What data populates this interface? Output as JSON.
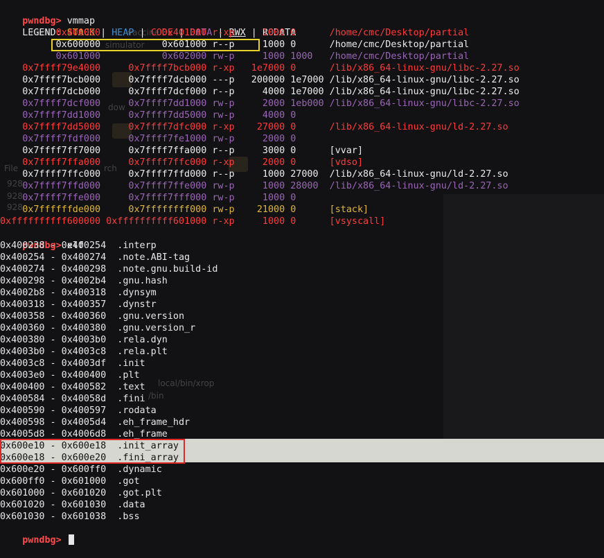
{
  "prompt": "pwndbg>",
  "colors": {
    "background": "#121214",
    "prompt": "#ff4b4b",
    "stack": "#e0b63a",
    "heap": "#3f8ed6",
    "code": "#ff3b3b",
    "data": "#9b65b8",
    "rodata": "#ececec",
    "highlight_band": "#d6d7d1",
    "yellow_box": "#e8d22a",
    "red_box": "#e02828"
  },
  "commands": {
    "vmmap": "vmmap",
    "elf": "elf"
  },
  "legend": {
    "prefix": "LEGEND: ",
    "stack": "STACK",
    "heap": "HEAP",
    "code": "CODE",
    "data": "DATA",
    "rwx": "RWX",
    "rodata": "RODATA",
    "sep": " | "
  },
  "vmmap_rows": [
    {
      "text": "          0x400000           0x401000 r-xp     1000 0      /home/cmc/Desktop/partial",
      "kind": "code"
    },
    {
      "text": "          0x600000           0x601000 r--p     1000 0      /home/cmc/Desktop/partial",
      "kind": "rodata"
    },
    {
      "text": "          0x601000           0x602000 rw-p     1000 1000   /home/cmc/Desktop/partial",
      "kind": "data"
    },
    {
      "text": "    0x7ffff79e4000     0x7ffff7bcb000 r-xp   1e7000 0      /lib/x86_64-linux-gnu/libc-2.27.so",
      "kind": "code"
    },
    {
      "text": "    0x7ffff7bcb000     0x7ffff7dcb000 ---p   200000 1e7000 /lib/x86_64-linux-gnu/libc-2.27.so",
      "kind": "rodata"
    },
    {
      "text": "    0x7ffff7dcb000     0x7ffff7dcf000 r--p     4000 1e7000 /lib/x86_64-linux-gnu/libc-2.27.so",
      "kind": "rodata"
    },
    {
      "text": "    0x7ffff7dcf000     0x7ffff7dd1000 rw-p     2000 1eb000 /lib/x86_64-linux-gnu/libc-2.27.so",
      "kind": "data"
    },
    {
      "text": "    0x7ffff7dd1000     0x7ffff7dd5000 rw-p     4000 0",
      "kind": "data"
    },
    {
      "text": "    0x7ffff7dd5000     0x7ffff7dfc000 r-xp    27000 0      /lib/x86_64-linux-gnu/ld-2.27.so",
      "kind": "code"
    },
    {
      "text": "    0x7ffff7fdf000     0x7ffff7fe1000 rw-p     2000 0",
      "kind": "data"
    },
    {
      "text": "    0x7ffff7ff7000     0x7ffff7ffa000 r--p     3000 0      [vvar]",
      "kind": "rodata"
    },
    {
      "text": "    0x7ffff7ffa000     0x7ffff7ffc000 r-xp     2000 0      [vdso]",
      "kind": "code"
    },
    {
      "text": "    0x7ffff7ffc000     0x7ffff7ffd000 r--p     1000 27000  /lib/x86_64-linux-gnu/ld-2.27.so",
      "kind": "rodata"
    },
    {
      "text": "    0x7ffff7ffd000     0x7ffff7ffe000 rw-p     1000 28000  /lib/x86_64-linux-gnu/ld-2.27.so",
      "kind": "data"
    },
    {
      "text": "    0x7ffff7ffe000     0x7ffff7fff000 rw-p     1000 0",
      "kind": "data"
    },
    {
      "text": "    0x7ffffffde000     0x7ffffffff000 rw-p    21000 0      [stack]",
      "kind": "stack"
    },
    {
      "text": "0xffffffffff600000 0xffffffffff601000 r-xp     1000 0      [vsyscall]",
      "kind": "code"
    }
  ],
  "elf_rows": [
    "0x400238 - 0x400254  .interp",
    "0x400254 - 0x400274  .note.ABI-tag",
    "0x400274 - 0x400298  .note.gnu.build-id",
    "0x400298 - 0x4002b4  .gnu.hash",
    "0x4002b8 - 0x400318  .dynsym",
    "0x400318 - 0x400357  .dynstr",
    "0x400358 - 0x400360  .gnu.version",
    "0x400360 - 0x400380  .gnu.version_r",
    "0x400380 - 0x4003b0  .rela.dyn",
    "0x4003b0 - 0x4003c8  .rela.plt",
    "0x4003c8 - 0x4003df  .init",
    "0x4003e0 - 0x400400  .plt",
    "0x400400 - 0x400582  .text",
    "0x400584 - 0x40058d  .fini",
    "0x400590 - 0x400597  .rodata",
    "0x400598 - 0x4005d4  .eh_frame_hdr",
    "0x4005d8 - 0x4006d8  .eh_frame",
    "0x600e10 - 0x600e18  .init_array",
    "0x600e18 - 0x600e20  .fini_array",
    "0x600e20 - 0x600ff0  .dynamic",
    "0x600ff0 - 0x601000  .got",
    "0x601000 - 0x601020  .got.plt",
    "0x601020 - 0x601030  .data",
    "0x601030 - 0x601038  .bss"
  ],
  "residue": {
    "a": "hack",
    "b": "vaccine",
    "c": "simulator",
    "d": "dow",
    "e": "File",
    "f": "rch",
    "g": "928",
    "h": "928",
    "i": "928",
    "j": "local/bin/xrop",
    "k": "/bin"
  }
}
